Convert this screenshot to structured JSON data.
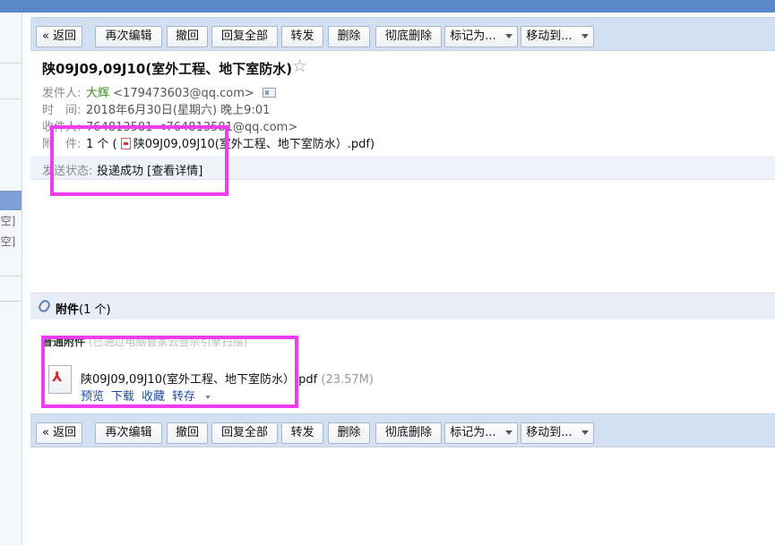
{
  "sidebar": {
    "labels": [
      "[空]",
      "[空]"
    ]
  },
  "toolbar": {
    "back": "« 返回",
    "edit_again": "再次编辑",
    "recall": "撤回",
    "reply_all": "回复全部",
    "forward": "转发",
    "delete": "删除",
    "delete_permanently": "彻底删除",
    "mark_as": "标记为...",
    "move_to": "移动到..."
  },
  "email": {
    "subject": "陕09J09,09J10(室外工程、地下室防水)",
    "from_label": "发件人:",
    "from_name": "大辉",
    "from_addr": "<179473603@qq.com>",
    "time_label": "时　间:",
    "time_value": "2018年6月30日(星期六) 晚上9:01",
    "to_label": "收件人:",
    "to_name": "764813581",
    "to_addr": "<764813581@qq.com>",
    "attach_label": "附　件:",
    "attach_count": "1 个 (",
    "attach_file": "陕09J09,09J10(室外工程、地下室防水）.pdf)",
    "status_label": "发送状态:",
    "status_value": "投递成功 [查看详情]"
  },
  "attachments": {
    "header_bold": "附件",
    "header_count": "(1 个)",
    "sub_bold": "普通附件",
    "sub_note": " (已通过电脑管家云查杀引擎扫描)",
    "file_name": "陕09J09,09J10(室外工程、地下室防水）.pdf",
    "file_size": " (23.57M)",
    "actions": [
      "预览",
      "下载",
      "收藏",
      "转存"
    ]
  }
}
